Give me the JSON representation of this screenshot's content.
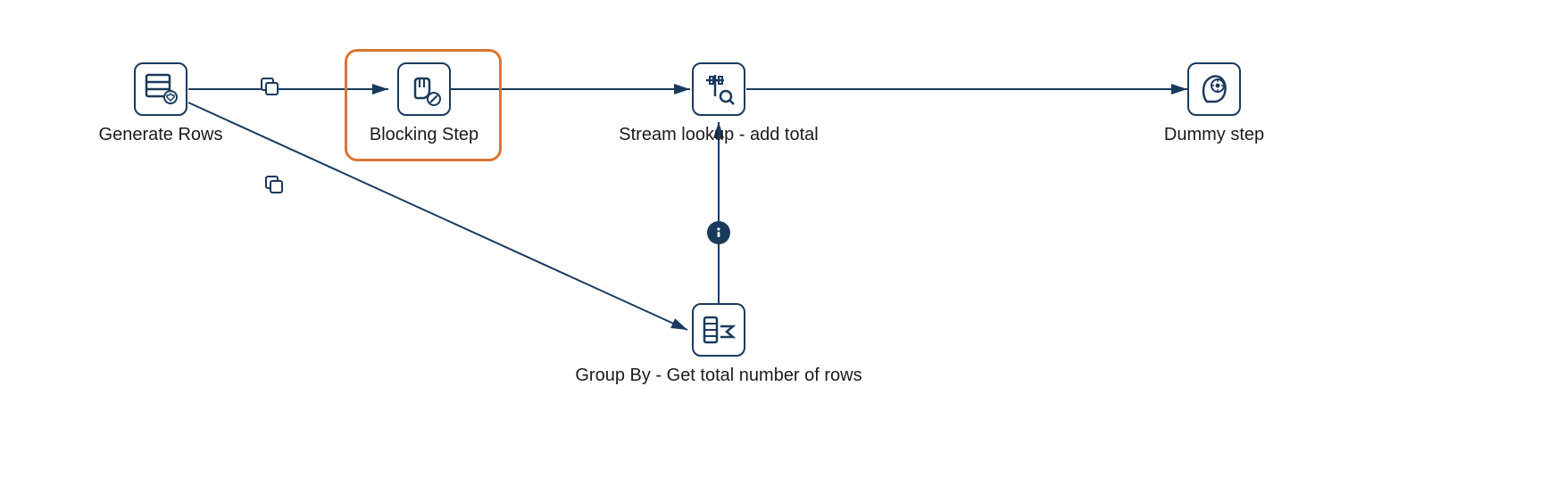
{
  "nodes": {
    "generate_rows": {
      "label": "Generate Rows"
    },
    "blocking_step": {
      "label": "Blocking Step"
    },
    "stream_lookup": {
      "label": "Stream lookup - add total"
    },
    "dummy_step": {
      "label": "Dummy step"
    },
    "group_by": {
      "label": "Group By - Get total number of rows"
    }
  },
  "colors": {
    "stroke": "#1a3a5c",
    "selection": "#d97533",
    "text": "#1a1a1a",
    "info_bg": "#1a3a5c"
  },
  "selected_node": "blocking_step"
}
